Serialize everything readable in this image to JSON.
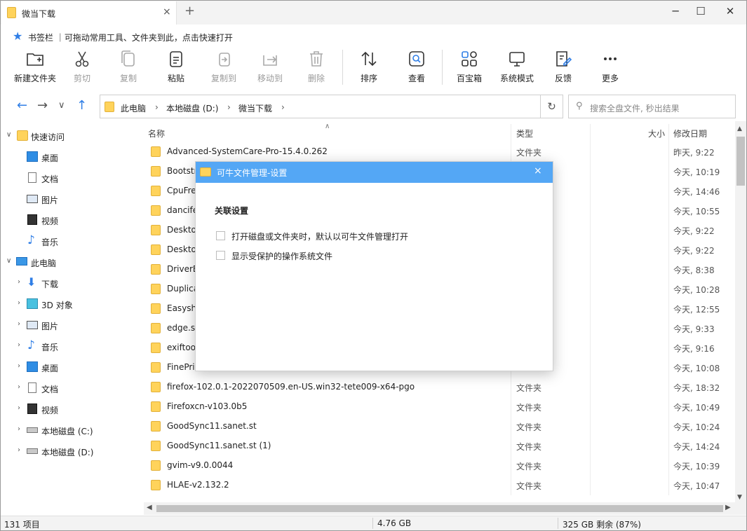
{
  "tab": {
    "title": "微当下载",
    "close": "×",
    "new_tab": "+"
  },
  "window_controls": {
    "minimize": "─",
    "maximize": "☐",
    "close": "✕"
  },
  "bookmark_bar": {
    "text": "书签栏 ｜可拖动常用工具、文件夹到此，点击快速打开"
  },
  "toolbar": [
    {
      "label": "新建文件夹",
      "icon": "new-folder-icon",
      "enabled": true
    },
    {
      "label": "剪切",
      "icon": "cut-icon",
      "enabled": false
    },
    {
      "label": "复制",
      "icon": "copy-icon",
      "enabled": false
    },
    {
      "label": "粘贴",
      "icon": "paste-icon",
      "enabled": true
    },
    {
      "label": "复制到",
      "icon": "copy-to-icon",
      "enabled": false
    },
    {
      "label": "移动到",
      "icon": "move-to-icon",
      "enabled": false
    },
    {
      "label": "删除",
      "icon": "delete-icon",
      "enabled": false
    },
    {
      "label": "排序",
      "icon": "sort-icon",
      "enabled": true
    },
    {
      "label": "查看",
      "icon": "view-icon",
      "enabled": true
    },
    {
      "label": "百宝箱",
      "icon": "toolbox-icon",
      "enabled": true
    },
    {
      "label": "系统模式",
      "icon": "system-mode-icon",
      "enabled": true
    },
    {
      "label": "反馈",
      "icon": "feedback-icon",
      "enabled": true
    },
    {
      "label": "更多",
      "icon": "more-icon",
      "enabled": true
    }
  ],
  "nav": {
    "breadcrumb": [
      "此电脑",
      "本地磁盘 (D:)",
      "微当下载"
    ],
    "search_placeholder": "搜索全盘文件, 秒出结果"
  },
  "sidebar": {
    "quick_access": "快速访问",
    "quick_items": [
      "桌面",
      "文档",
      "图片",
      "视频",
      "音乐"
    ],
    "this_pc": "此电脑",
    "pc_items": [
      "下载",
      "3D 对象",
      "图片",
      "音乐",
      "桌面",
      "文档",
      "视频",
      "本地磁盘 (C:)",
      "本地磁盘 (D:)"
    ]
  },
  "columns": {
    "name": "名称",
    "type": "类型",
    "size": "大小",
    "modified": "修改日期"
  },
  "files": [
    {
      "name": "Advanced-SystemCare-Pro-15.4.0.262",
      "type": "文件夹",
      "date": "昨天, 9:22"
    },
    {
      "name": "Bootstr",
      "type": "",
      "date": "今天, 10:19"
    },
    {
      "name": "CpuFre",
      "type": "",
      "date": "今天, 14:46"
    },
    {
      "name": "dancife",
      "type": "",
      "date": "今天, 10:55"
    },
    {
      "name": "Deskto",
      "type": "",
      "date": "今天, 9:22"
    },
    {
      "name": "Deskto",
      "type": "",
      "date": "今天, 9:22"
    },
    {
      "name": "DriverE",
      "type": "",
      "date": "今天, 8:38"
    },
    {
      "name": "Duplica",
      "type": "",
      "date": "今天, 10:28"
    },
    {
      "name": "Easysh",
      "type": "",
      "date": "今天, 12:55"
    },
    {
      "name": "edge.s",
      "type": "",
      "date": "今天, 9:33"
    },
    {
      "name": "exiftoo",
      "type": "",
      "date": "今天, 9:16"
    },
    {
      "name": "FinePri",
      "type": "",
      "date": "今天, 10:08"
    },
    {
      "name": "firefox-102.0.1-2022070509.en-US.win32-tete009-x64-pgo",
      "type": "文件夹",
      "date": "今天, 18:32"
    },
    {
      "name": "Firefoxcn-v103.0b5",
      "type": "文件夹",
      "date": "今天, 10:49"
    },
    {
      "name": "GoodSync11.sanet.st",
      "type": "文件夹",
      "date": "今天, 10:24"
    },
    {
      "name": "GoodSync11.sanet.st (1)",
      "type": "文件夹",
      "date": "今天, 14:24"
    },
    {
      "name": "gvim-v9.0.0044",
      "type": "文件夹",
      "date": "今天, 10:39"
    },
    {
      "name": "HLAE-v2.132.2",
      "type": "文件夹",
      "date": "今天, 10:47"
    }
  ],
  "status": {
    "count": "131 项目",
    "size": "4.76 GB",
    "free": "325 GB 剩余 (87%)"
  },
  "dialog": {
    "title": "可牛文件管理-设置",
    "close": "×",
    "heading": "关联设置",
    "options": [
      {
        "label": "打开磁盘或文件夹时，默认以可牛文件管理打开",
        "checked": false
      },
      {
        "label": "显示受保护的操作系统文件",
        "checked": false
      }
    ]
  },
  "colors": {
    "accent": "#2f7ee6",
    "dialog_title": "#54a7f5",
    "folder": "#ffd35b"
  }
}
